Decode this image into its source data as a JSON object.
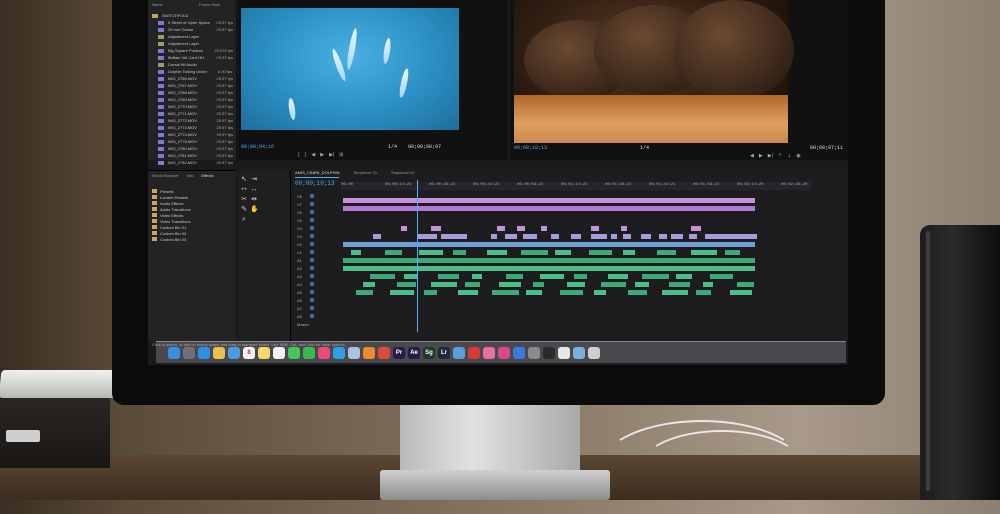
{
  "project_panel": {
    "header": {
      "name": "Name",
      "rate": "Frame Rate"
    },
    "folder": "SWITCHFOLD",
    "items": [
      {
        "name": "5 Street of Open Space",
        "fps": "29.97 fps"
      },
      {
        "name": "30 mm Ocean",
        "fps": "29.97 fps"
      },
      {
        "name": "Adjustment Layer",
        "fps": ""
      },
      {
        "name": "Adjustment Layer",
        "fps": ""
      },
      {
        "name": "Big Square Product",
        "fps": "23.976 fps"
      },
      {
        "name": "Buffalo Vid Card HH",
        "fps": "29.97 fps"
      },
      {
        "name": "Dorsal Hit Audio",
        "fps": ""
      },
      {
        "name": "Dolphin Talking Under",
        "fps": "6.00 fps"
      },
      {
        "name": "IMG_2766.MOV",
        "fps": "29.97 fps"
      },
      {
        "name": "IMG_2767.MOV",
        "fps": "29.97 fps"
      },
      {
        "name": "IMG_2768.MOV",
        "fps": "29.97 fps"
      },
      {
        "name": "IMG_2769.MOV",
        "fps": "29.97 fps"
      },
      {
        "name": "IMG_2770.MOV",
        "fps": "29.97 fps"
      },
      {
        "name": "IMG_2771.MOV",
        "fps": "29.97 fps"
      },
      {
        "name": "IMG_2772.MOV",
        "fps": "29.97 fps"
      },
      {
        "name": "IMG_2773.MOV",
        "fps": "29.97 fps"
      },
      {
        "name": "IMG_2774.MOV",
        "fps": "29.97 fps"
      },
      {
        "name": "IMG_2775.MOV",
        "fps": "29.97 fps"
      },
      {
        "name": "IMG_2780.MOV",
        "fps": "29.97 fps"
      },
      {
        "name": "IMG_2781.MOV",
        "fps": "29.97 fps"
      },
      {
        "name": "IMG_2782.MOV",
        "fps": "29.97 fps"
      }
    ]
  },
  "source_monitor": {
    "timecode_in": "00;00;04;16",
    "timecode_dur": "00;00;08;07",
    "zoom": "1/4"
  },
  "program_monitor": {
    "timecode": "00;00;10;13",
    "timecode_end": "00;00;07;11",
    "zoom": "1/4"
  },
  "effects_panel": {
    "tabs": [
      "Media Browser",
      "Info",
      "Effects"
    ],
    "active_tab": "Effects",
    "items": [
      "Presets",
      "Lumetri Presets",
      "Audio Effects",
      "Audio Transitions",
      "Video Effects",
      "Video Transitions",
      "Custom Bin 01",
      "Custom Bin 02",
      "Custom Bin 03"
    ]
  },
  "timeline": {
    "tabs": [
      "AMIS_CINEN_DOLPHIN",
      "Sequence 01",
      "Sequence 02"
    ],
    "playhead_timecode": "00;00;10;13",
    "ruler": [
      "00;00",
      "00;00;14;23",
      "00;00;29;23",
      "00;00;44;22",
      "00;00;59;22",
      "00;01;14;22",
      "00;01;29;21",
      "00;01;44;21",
      "00;01;59;21",
      "00;02;14;20",
      "00;02;29;20"
    ],
    "video_tracks": [
      "V8",
      "V7",
      "V6",
      "V5",
      "V4",
      "V3",
      "V2",
      "V1"
    ],
    "audio_tracks": [
      "A1",
      "A2",
      "A3",
      "A4",
      "A5",
      "A6",
      "A7",
      "A8"
    ],
    "master": "Master"
  },
  "status_bar": "Click to select, or click in empty space and drag to marquee select. Use Shift, Opt, and Cmd for other options.",
  "dock": [
    {
      "name": "finder-icon",
      "label": "",
      "color": "#3b8de0"
    },
    {
      "name": "launchpad-icon",
      "label": "",
      "color": "#6f6f7a"
    },
    {
      "name": "safari-icon",
      "label": "",
      "color": "#2f8fe8"
    },
    {
      "name": "photos-icon",
      "label": "",
      "color": "#e9c24a"
    },
    {
      "name": "mail-icon",
      "label": "",
      "color": "#4a9be0"
    },
    {
      "name": "calendar-icon",
      "label": "8",
      "color": "#f2f2f2"
    },
    {
      "name": "notes-icon",
      "label": "",
      "color": "#f5d76e"
    },
    {
      "name": "reminders-icon",
      "label": "",
      "color": "#f2f2f2"
    },
    {
      "name": "messages-icon",
      "label": "",
      "color": "#43c65a"
    },
    {
      "name": "facetime-icon",
      "label": "",
      "color": "#3cb94e"
    },
    {
      "name": "itunes-icon",
      "label": "",
      "color": "#e84a7a"
    },
    {
      "name": "appstore-icon",
      "label": "",
      "color": "#2f9ee8"
    },
    {
      "name": "preview-icon",
      "label": "",
      "color": "#a9c4e0"
    },
    {
      "name": "ibooks-icon",
      "label": "",
      "color": "#ef8b2d"
    },
    {
      "name": "chrome-icon",
      "label": "",
      "color": "#d94a3a"
    },
    {
      "name": "premiere-icon",
      "label": "Pr",
      "color": "#2a1a4a"
    },
    {
      "name": "aftereffects-icon",
      "label": "Ae",
      "color": "#2a1a4a"
    },
    {
      "name": "speedgrade-icon",
      "label": "Sg",
      "color": "#1a3a2a"
    },
    {
      "name": "lightroom-icon",
      "label": "Lr",
      "color": "#1a2a3a"
    },
    {
      "name": "globe-icon",
      "label": "",
      "color": "#5aa0d8"
    },
    {
      "name": "creative-cloud-icon",
      "label": "",
      "color": "#d63a3a"
    },
    {
      "name": "itunes-2-icon",
      "label": "",
      "color": "#e86fa0"
    },
    {
      "name": "music-icon",
      "label": "",
      "color": "#d84a8a"
    },
    {
      "name": "compass-icon",
      "label": "",
      "color": "#3a7ad8"
    },
    {
      "name": "system-prefs-icon",
      "label": "",
      "color": "#8a8a8a"
    },
    {
      "name": "terminal-icon",
      "label": "",
      "color": "#2a2a2a"
    },
    {
      "name": "document-icon",
      "label": "",
      "color": "#e8e8e8"
    },
    {
      "name": "folder-icon",
      "label": "",
      "color": "#7ab0e0"
    },
    {
      "name": "trash-icon",
      "label": "",
      "color": "#cfcfcf"
    }
  ]
}
